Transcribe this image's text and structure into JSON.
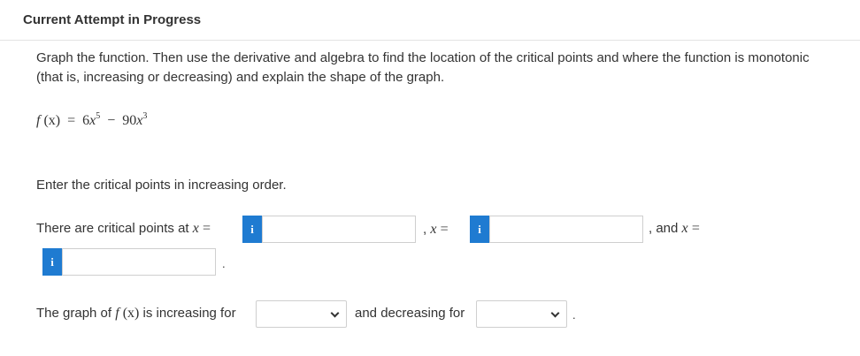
{
  "header": {
    "title": "Current Attempt in Progress"
  },
  "question": {
    "instruction_line1": "Graph the function. Then use the derivative and algebra to find the location of the critical points and where the function is monotonic",
    "instruction_line2": "(that is, increasing or decreasing) and explain the shape of the graph.",
    "function": {
      "lhs_name": "f",
      "lhs_arg": "(x)",
      "equals": "=",
      "term1_coef": "6",
      "term1_var": "x",
      "term1_exp": "5",
      "minus": "−",
      "term2_coef": "90",
      "term2_var": "x",
      "term2_exp": "3"
    },
    "prompt_order": "Enter the critical points in increasing order.",
    "critical_points": {
      "lead_text": "There are critical points at",
      "var": "x",
      "equals": "=",
      "comma": ",",
      "and_text": ", and",
      "period": ".",
      "info_icon_glyph": "i",
      "info_icon_name": "info-icon",
      "answers": [
        "",
        "",
        ""
      ]
    },
    "monotonic": {
      "lead_text": "The graph of",
      "func_name": "f",
      "func_arg": "(x)",
      "increasing_text": "is increasing for",
      "decreasing_text": "and decreasing for",
      "period": ".",
      "increasing_selected": "",
      "decreasing_selected": ""
    }
  },
  "colors": {
    "info_icon_bg": "#1f7bd1",
    "border": "#cfcfcf",
    "text": "#333333"
  }
}
